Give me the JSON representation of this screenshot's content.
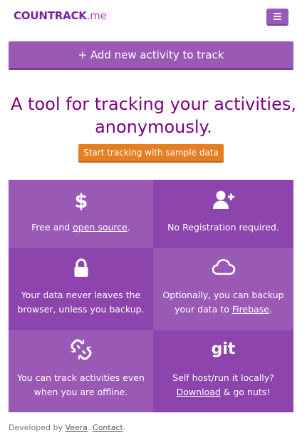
{
  "colors": {
    "brand": "#7b1fa2",
    "primary_purple": "#9b59b6",
    "dark_purple": "#8e44ad",
    "headline": "#800080",
    "orange": "#e67e22"
  },
  "navbar": {
    "brand_main": "COUNTRACK",
    "brand_suffix": ".me",
    "menu_icon": "hamburger-icon"
  },
  "add_button": {
    "label": "+ Add new activity to track"
  },
  "hero": {
    "line1": "A tool for tracking your activities,",
    "line2": "anonymously.",
    "sample_button": "Start tracking with sample data"
  },
  "features": [
    {
      "icon": "dollar-icon",
      "text_before": "Free and ",
      "link": "open source",
      "text_after": "."
    },
    {
      "icon": "add-user-icon",
      "text": "No Registration required."
    },
    {
      "icon": "lock-icon",
      "line1": "Your data never leaves the",
      "line2": "browser, unless you backup."
    },
    {
      "icon": "cloud-icon",
      "line1": "Optionally, you can backup",
      "line2_before": "your data to ",
      "line2_link": "Firebase",
      "line2_after": "."
    },
    {
      "icon": "broken-link-icon",
      "line1": "You can track activities even",
      "line2": "when you are offline."
    },
    {
      "icon": "git-icon",
      "icon_text": "git",
      "line1": "Self host/run it locally?",
      "line2_link": "Download",
      "line2_after": " & go nuts!"
    }
  ],
  "footer": {
    "prefix": "Developed by ",
    "author_link": "Veera",
    "separator": ". ",
    "contact_link": "Contact",
    "suffix": "."
  }
}
